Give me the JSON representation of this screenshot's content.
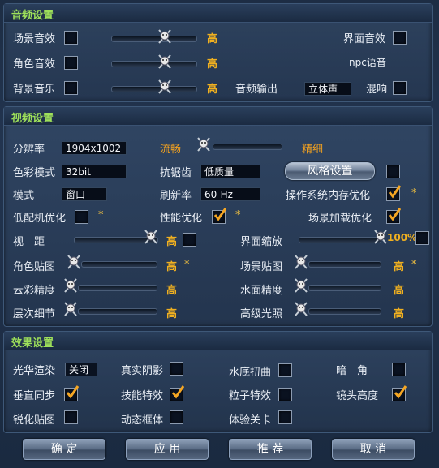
{
  "audio": {
    "title": "音频设置",
    "scene_sound": "场景音效",
    "role_sound": "角色音效",
    "bgm": "背景音乐",
    "scene_level": "高",
    "role_level": "高",
    "bgm_level": "高",
    "ui_sound": "界面音效",
    "npc_voice": "npc语音",
    "output_label": "音频输出",
    "output_value": "立体声",
    "reverb": "混响"
  },
  "video": {
    "title": "视频设置",
    "resolution_label": "分辨率",
    "resolution_value": "1904x1002",
    "color_label": "色彩模式",
    "color_value": "32bit",
    "mode_label": "模式",
    "mode_value": "窗口",
    "low_opt": "低配机优化",
    "quality_low": "流畅",
    "quality_high": "精细",
    "aa_label": "抗锯齿",
    "aa_value": "低质量",
    "style_btn": "风格设置",
    "refresh_label": "刷新率",
    "refresh_value": "60-Hz",
    "os_mem": "操作系统内存优化",
    "perf_opt": "性能优化",
    "scene_load": "场景加载优化",
    "view_dist": "视　距",
    "view_dist_level": "高",
    "ui_scale": "界面缩放",
    "ui_scale_value": "100%",
    "role_tex": "角色贴图",
    "role_tex_level": "高",
    "scene_tex": "场景贴图",
    "scene_tex_level": "高",
    "cloud": "云彩精度",
    "cloud_level": "高",
    "water": "水面精度",
    "water_level": "高",
    "lod": "层次细节",
    "lod_level": "高",
    "light": "高级光照",
    "light_level": "高",
    "star": "*"
  },
  "effects": {
    "title": "效果设置",
    "bloom": "光华渲染",
    "bloom_value": "关闭",
    "shadow": "真实阴影",
    "underwater": "水底扭曲",
    "dark": "暗　角",
    "vsync": "垂直同步",
    "skill": "技能特效",
    "particle": "粒子特效",
    "camera": "镜头高度",
    "sharpen": "锐化贴图",
    "motion": "动态框体",
    "dungeon": "体验关卡"
  },
  "buttons": {
    "ok": "确 定",
    "apply": "应 用",
    "recommend": "推 荐",
    "cancel": "取 消"
  },
  "colors": {
    "section_title": "#9ee05a",
    "level_value": "#f0b020",
    "check_mark": "#f5a623"
  }
}
